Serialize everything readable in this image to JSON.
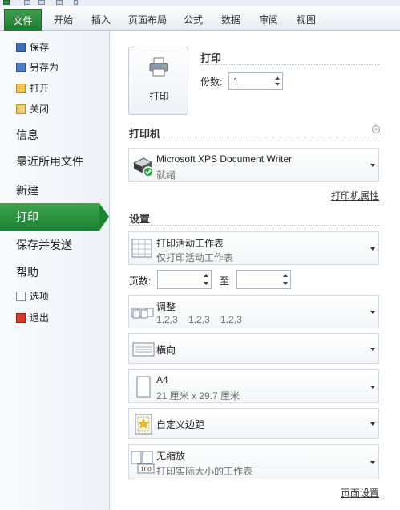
{
  "ribbon": {
    "tabs": [
      "文件",
      "开始",
      "插入",
      "页面布局",
      "公式",
      "数据",
      "审阅",
      "视图"
    ]
  },
  "nav": {
    "save": "保存",
    "save_as": "另存为",
    "open": "打开",
    "close": "关闭",
    "info": "信息",
    "recent": "最近所用文件",
    "new": "新建",
    "print": "打印",
    "save_send": "保存并发送",
    "help": "帮助",
    "options": "选项",
    "exit": "退出"
  },
  "print": {
    "button_label": "打印",
    "header": "打印",
    "copies_label": "份数:",
    "copies_value": "1"
  },
  "printer": {
    "section": "打印机",
    "info_glyph": "i",
    "name": "Microsoft XPS Document Writer",
    "status": "就绪",
    "properties_link": "打印机属性"
  },
  "settings": {
    "section": "设置",
    "scope_title": "打印活动工作表",
    "scope_sub": "仅打印活动工作表",
    "pages_label": "页数:",
    "pages_to": "至",
    "pages_from_value": "",
    "pages_to_value": "",
    "collate_title": "调整",
    "collate_sub": "1,2,3    1,2,3    1,2,3",
    "orientation": "横向",
    "paper_title": "A4",
    "paper_sub": "21 厘米 x 29.7 厘米",
    "margins": "自定义边距",
    "scaling_title": "无缩放",
    "scaling_sub": "打印实际大小的工作表",
    "scaling_badge": "100",
    "page_setup_link": "页面设置"
  }
}
